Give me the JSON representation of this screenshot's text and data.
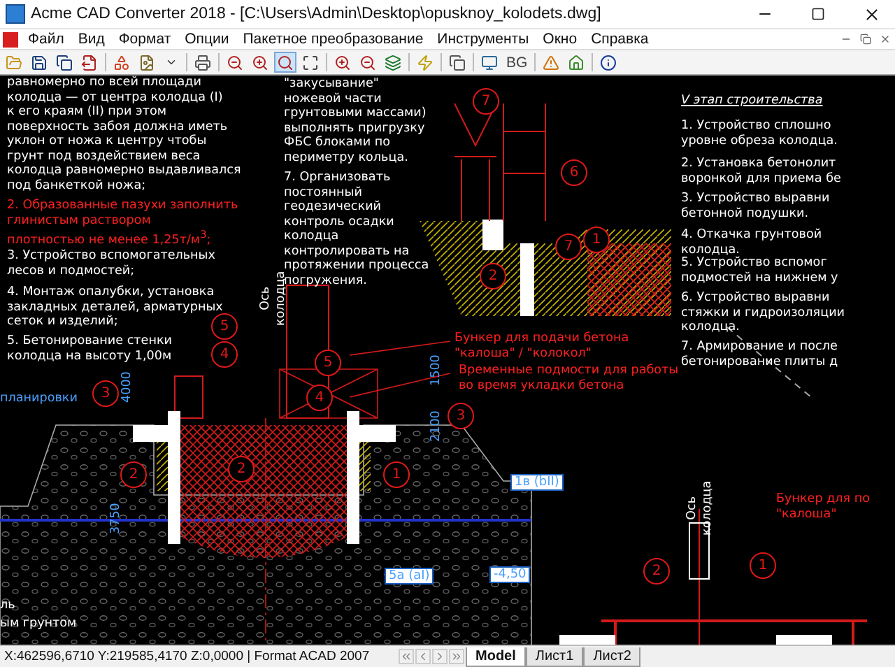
{
  "window": {
    "title": "Acme CAD Converter 2018 - [C:\\Users\\Admin\\Desktop\\opusknoy_kolodets.dwg]"
  },
  "menu": [
    "Файл",
    "Вид",
    "Формат",
    "Опции",
    "Пакетное преобразование",
    "Инструменты",
    "Окно",
    "Справка"
  ],
  "toolbar": [
    {
      "kind": "open",
      "selected": false
    },
    {
      "kind": "save",
      "selected": false
    },
    {
      "kind": "save-all",
      "selected": false
    },
    {
      "kind": "export",
      "selected": false
    },
    {
      "kind": "sep"
    },
    {
      "kind": "convert",
      "selected": false
    },
    {
      "kind": "image",
      "selected": false
    },
    {
      "kind": "dropdown",
      "selected": false
    },
    {
      "kind": "sep"
    },
    {
      "kind": "print",
      "selected": false
    },
    {
      "kind": "sep"
    },
    {
      "kind": "zoom-out",
      "selected": false
    },
    {
      "kind": "zoom-in",
      "selected": false
    },
    {
      "kind": "zoom-window",
      "selected": true
    },
    {
      "kind": "zoom-extents",
      "selected": false
    },
    {
      "kind": "sep"
    },
    {
      "kind": "zoom-in",
      "selected": false
    },
    {
      "kind": "zoom-out",
      "selected": false
    },
    {
      "kind": "layers",
      "selected": false
    },
    {
      "kind": "sep"
    },
    {
      "kind": "bolt",
      "selected": false
    },
    {
      "kind": "sep"
    },
    {
      "kind": "copy",
      "selected": false
    },
    {
      "kind": "sep"
    },
    {
      "kind": "monitor",
      "selected": false
    },
    {
      "kind": "text",
      "label": "BG",
      "selected": false
    },
    {
      "kind": "sep"
    },
    {
      "kind": "warning",
      "selected": false
    },
    {
      "kind": "home",
      "selected": false
    },
    {
      "kind": "sep"
    },
    {
      "kind": "info",
      "selected": false
    }
  ],
  "notes": [
    {
      "kind": "text",
      "color": "#ffffff",
      "text": "равномерно по всей площади\nколодца — от центра колодца (I)\nк его краям (II) при этом\nповерхность забоя должна иметь\nуклон от ножа к центру чтобы\nгрунт под воздействием веса\nколодца равномерно выдавливался\nпод банкеткой ножа;"
    },
    {
      "kind": "text",
      "color": "#ff2020",
      "text": "2. Образованные пазухи заполнить\nглинистым раствором\nплотностью не менее 1,25т/м$^{3}$;"
    },
    {
      "kind": "text",
      "color": "#ffffff",
      "text": "3. Устройство вспомогательных\nлесов и подмостей;"
    },
    {
      "kind": "text",
      "color": "#ffffff",
      "text": "4. Монтаж опалубки, установка\nзакладных деталей, арматурных\nсеток и изделий;"
    },
    {
      "kind": "text",
      "color": "#ffffff",
      "text": "5. Бетонирование стенки\nколодца на высоту 1,00м"
    },
    {
      "kind": "text",
      "color": "#ffffff",
      "text": "\"закусывание\"\nножевой части\nгрунтовыми массами)\nвыполнять пригрузку\nФБС блоками по\nпериметру кольца."
    },
    {
      "kind": "text",
      "color": "#ffffff",
      "text": "7. Организовать\nпостоянный\nгеодезический\nконтроль осадки\nколодца\nконтролировать на\nпротяжении процесса\nпогружения."
    },
    {
      "kind": "text",
      "color": "#ff2020",
      "text": "Бункер для подачи бетона\n\"калоша\" / \"колокол\""
    },
    {
      "kind": "text",
      "color": "#ff2020",
      "text": "Временные подмости для работы\nво время укладки бетона"
    },
    {
      "kind": "heading",
      "color": "#ffffff",
      "text": "V этап строительства"
    },
    {
      "kind": "text",
      "color": "#ffffff",
      "text": "1. Устройство сплошно\nуровне обреза колодца."
    },
    {
      "kind": "text",
      "color": "#ffffff",
      "text": "2. Установка бетонолит\nворонкой для приема бе"
    },
    {
      "kind": "text",
      "color": "#ffffff",
      "text": "3. Устройство выравни\nбетонной подушки."
    },
    {
      "kind": "text",
      "color": "#ffffff",
      "text": "4. Откачка грунтовой\nколодца."
    },
    {
      "kind": "text",
      "color": "#ffffff",
      "text": "5. Устройство вспомог\nподмостей на нижнем у"
    },
    {
      "kind": "text",
      "color": "#ffffff",
      "text": "6. Устройство выравни\nстяжки и гидроизоляции\nколодца."
    },
    {
      "kind": "text",
      "color": "#ffffff",
      "text": "7. Армирование и после\nбетонирование плиты д"
    },
    {
      "kind": "vertical",
      "color": "#ffffff",
      "text": "Ось\nколодца"
    },
    {
      "kind": "vertical",
      "color": "#ffffff",
      "text": "Ось\nколодца"
    },
    {
      "kind": "text",
      "color": "#4aa0ff",
      "text": "планировки"
    },
    {
      "kind": "dimension",
      "color": "#4aa0ff",
      "text": "1500"
    },
    {
      "kind": "dimension",
      "color": "#4aa0ff",
      "text": "2100"
    },
    {
      "kind": "dimension",
      "color": "#4aa0ff",
      "text": "4000"
    },
    {
      "kind": "dimension",
      "color": "#4aa0ff",
      "text": "3750"
    },
    {
      "kind": "tag",
      "color": "#4aa0ff",
      "text": "1в (bII)"
    },
    {
      "kind": "tag",
      "color": "#4aa0ff",
      "text": "5а (aI)"
    },
    {
      "kind": "tag",
      "color": "#4aa0ff",
      "text": "-4,50"
    },
    {
      "kind": "text",
      "color": "#ffffff",
      "text": "ль"
    },
    {
      "kind": "text",
      "color": "#ffffff",
      "text": "ым грунтом"
    },
    {
      "kind": "text",
      "color": "#ff2020",
      "text": "Бункер для по\n\"калоша\""
    }
  ],
  "callouts": [
    {
      "label": "7"
    },
    {
      "label": "6"
    },
    {
      "label": "7"
    },
    {
      "label": "1"
    },
    {
      "label": "2"
    },
    {
      "label": "5"
    },
    {
      "label": "4"
    },
    {
      "label": "3"
    },
    {
      "label": "5"
    },
    {
      "label": "4"
    },
    {
      "label": "3"
    },
    {
      "label": "2"
    },
    {
      "label": "1"
    },
    {
      "label": "2"
    },
    {
      "label": "2"
    },
    {
      "label": "1"
    }
  ],
  "status_bar": {
    "coordinates": "X:462596,6710 Y:219585,4170 Z:0,0000 | Format ACAD 2007"
  },
  "sheet_tabs": [
    {
      "label": "Model",
      "selected": true
    },
    {
      "label": "Лист1",
      "selected": false
    },
    {
      "label": "Лист2",
      "selected": false
    }
  ]
}
